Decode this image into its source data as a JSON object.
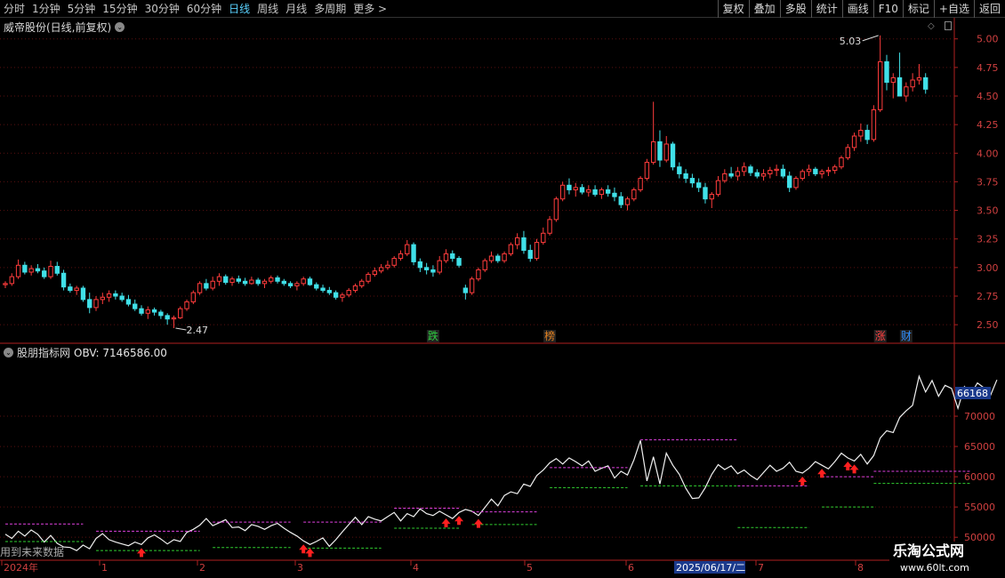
{
  "toolbar": {
    "periods": [
      "分时",
      "1分钟",
      "5分钟",
      "15分钟",
      "30分钟",
      "60分钟",
      "日线",
      "周线",
      "月线",
      "多周期",
      "更多 >"
    ],
    "active_period": "日线",
    "actions": [
      "复权",
      "叠加",
      "多股",
      "统计",
      "画线",
      "F10",
      "标记",
      "+自选",
      "返回"
    ]
  },
  "main_chart": {
    "title": "威帝股份(日线,前复权)",
    "high_label": "5.03",
    "low_label": "2.47",
    "price_ticks": [
      "5.00",
      "4.75",
      "4.50",
      "4.25",
      "4.00",
      "3.75",
      "3.50",
      "3.25",
      "3.00",
      "2.75",
      "2.50"
    ],
    "markers": [
      {
        "text": "跌",
        "color": "#2ecc40"
      },
      {
        "text": "榜",
        "color": "#e08020"
      },
      {
        "text": "涨",
        "color": "#ff4040"
      },
      {
        "text": "财",
        "color": "#3090ff"
      }
    ]
  },
  "indicator": {
    "title": "股朋指标网",
    "obv_label": "OBV: 7146586.00",
    "current_value": "66168",
    "ticks": [
      "70000",
      "65000",
      "60000",
      "55000",
      "50000"
    ]
  },
  "date_axis": {
    "labels": [
      "2024年",
      "1",
      "2",
      "3",
      "4",
      "5",
      "6",
      "7",
      "8"
    ],
    "cursor_date": "2025/06/17/二"
  },
  "bottom_note": "用到未来数据",
  "watermark": {
    "name": "乐淘公式网",
    "url": "www.60lt.com"
  },
  "chart_data": {
    "type": "candlestick",
    "candles": [
      [
        2.85,
        2.88,
        2.82,
        2.86
      ],
      [
        2.86,
        2.95,
        2.84,
        2.92
      ],
      [
        2.92,
        3.07,
        2.9,
        3.02
      ],
      [
        3.02,
        3.05,
        2.94,
        2.96
      ],
      [
        2.96,
        3.02,
        2.93,
        2.99
      ],
      [
        2.99,
        3.03,
        2.95,
        2.97
      ],
      [
        2.97,
        3.0,
        2.9,
        2.92
      ],
      [
        2.92,
        3.06,
        2.9,
        3.01
      ],
      [
        3.01,
        3.05,
        2.93,
        2.95
      ],
      [
        2.95,
        2.98,
        2.8,
        2.83
      ],
      [
        2.83,
        2.86,
        2.78,
        2.8
      ],
      [
        2.8,
        2.84,
        2.76,
        2.82
      ],
      [
        2.82,
        2.84,
        2.7,
        2.72
      ],
      [
        2.72,
        2.78,
        2.6,
        2.65
      ],
      [
        2.65,
        2.75,
        2.62,
        2.72
      ],
      [
        2.72,
        2.78,
        2.68,
        2.74
      ],
      [
        2.74,
        2.8,
        2.7,
        2.77
      ],
      [
        2.77,
        2.8,
        2.72,
        2.75
      ],
      [
        2.75,
        2.78,
        2.7,
        2.72
      ],
      [
        2.72,
        2.76,
        2.66,
        2.68
      ],
      [
        2.68,
        2.72,
        2.62,
        2.64
      ],
      [
        2.64,
        2.67,
        2.58,
        2.6
      ],
      [
        2.6,
        2.66,
        2.55,
        2.63
      ],
      [
        2.63,
        2.65,
        2.58,
        2.61
      ],
      [
        2.61,
        2.63,
        2.55,
        2.58
      ],
      [
        2.58,
        2.6,
        2.5,
        2.55
      ],
      [
        2.55,
        2.58,
        2.47,
        2.56
      ],
      [
        2.56,
        2.66,
        2.55,
        2.64
      ],
      [
        2.64,
        2.72,
        2.62,
        2.7
      ],
      [
        2.7,
        2.8,
        2.68,
        2.78
      ],
      [
        2.78,
        2.88,
        2.76,
        2.86
      ],
      [
        2.86,
        2.9,
        2.8,
        2.82
      ],
      [
        2.82,
        2.92,
        2.8,
        2.88
      ],
      [
        2.88,
        2.95,
        2.84,
        2.92
      ],
      [
        2.92,
        2.94,
        2.85,
        2.87
      ],
      [
        2.87,
        2.92,
        2.84,
        2.9
      ],
      [
        2.9,
        2.93,
        2.86,
        2.88
      ],
      [
        2.88,
        2.91,
        2.84,
        2.86
      ],
      [
        2.86,
        2.92,
        2.85,
        2.89
      ],
      [
        2.89,
        2.91,
        2.84,
        2.86
      ],
      [
        2.86,
        2.9,
        2.82,
        2.88
      ],
      [
        2.88,
        2.93,
        2.86,
        2.91
      ],
      [
        2.91,
        2.93,
        2.86,
        2.88
      ],
      [
        2.88,
        2.9,
        2.84,
        2.86
      ],
      [
        2.86,
        2.88,
        2.82,
        2.84
      ],
      [
        2.84,
        2.88,
        2.8,
        2.86
      ],
      [
        2.86,
        2.92,
        2.84,
        2.9
      ],
      [
        2.9,
        2.92,
        2.84,
        2.85
      ],
      [
        2.85,
        2.87,
        2.8,
        2.82
      ],
      [
        2.82,
        2.85,
        2.78,
        2.8
      ],
      [
        2.8,
        2.83,
        2.76,
        2.78
      ],
      [
        2.78,
        2.8,
        2.72,
        2.74
      ],
      [
        2.74,
        2.78,
        2.7,
        2.76
      ],
      [
        2.76,
        2.82,
        2.74,
        2.8
      ],
      [
        2.8,
        2.86,
        2.78,
        2.84
      ],
      [
        2.84,
        2.9,
        2.82,
        2.88
      ],
      [
        2.88,
        2.96,
        2.86,
        2.94
      ],
      [
        2.94,
        3.0,
        2.92,
        2.97
      ],
      [
        2.97,
        3.03,
        2.95,
        3.0
      ],
      [
        3.0,
        3.06,
        2.98,
        3.02
      ],
      [
        3.02,
        3.1,
        3.0,
        3.08
      ],
      [
        3.08,
        3.15,
        3.06,
        3.12
      ],
      [
        3.12,
        3.24,
        3.1,
        3.2
      ],
      [
        3.2,
        3.22,
        3.02,
        3.05
      ],
      [
        3.05,
        3.08,
        2.96,
        3.0
      ],
      [
        3.0,
        3.04,
        2.94,
        2.98
      ],
      [
        2.98,
        3.02,
        2.92,
        2.96
      ],
      [
        2.96,
        3.1,
        2.94,
        3.06
      ],
      [
        3.06,
        3.16,
        3.04,
        3.12
      ],
      [
        3.12,
        3.15,
        3.05,
        3.08
      ],
      [
        3.08,
        3.1,
        3.0,
        3.02
      ],
      [
        2.82,
        2.85,
        2.72,
        2.78
      ],
      [
        2.78,
        2.92,
        2.76,
        2.9
      ],
      [
        2.9,
        3.0,
        2.88,
        2.98
      ],
      [
        2.98,
        3.08,
        2.96,
        3.06
      ],
      [
        3.06,
        3.14,
        3.04,
        3.1
      ],
      [
        3.1,
        3.12,
        3.04,
        3.06
      ],
      [
        3.06,
        3.14,
        3.04,
        3.12
      ],
      [
        3.12,
        3.22,
        3.1,
        3.2
      ],
      [
        3.2,
        3.3,
        3.16,
        3.26
      ],
      [
        3.26,
        3.32,
        3.12,
        3.15
      ],
      [
        3.15,
        3.2,
        3.05,
        3.08
      ],
      [
        3.08,
        3.25,
        3.06,
        3.22
      ],
      [
        3.22,
        3.35,
        3.2,
        3.3
      ],
      [
        3.3,
        3.45,
        3.28,
        3.42
      ],
      [
        3.42,
        3.62,
        3.4,
        3.6
      ],
      [
        3.6,
        3.75,
        3.58,
        3.72
      ],
      [
        3.72,
        3.78,
        3.64,
        3.68
      ],
      [
        3.68,
        3.74,
        3.62,
        3.7
      ],
      [
        3.7,
        3.73,
        3.64,
        3.66
      ],
      [
        3.66,
        3.72,
        3.62,
        3.68
      ],
      [
        3.68,
        3.72,
        3.62,
        3.64
      ],
      [
        3.64,
        3.7,
        3.6,
        3.68
      ],
      [
        3.68,
        3.72,
        3.62,
        3.65
      ],
      [
        3.65,
        3.7,
        3.58,
        3.62
      ],
      [
        3.62,
        3.66,
        3.52,
        3.55
      ],
      [
        3.55,
        3.62,
        3.5,
        3.6
      ],
      [
        3.6,
        3.7,
        3.58,
        3.68
      ],
      [
        3.68,
        3.8,
        3.66,
        3.78
      ],
      [
        3.78,
        3.95,
        3.76,
        3.92
      ],
      [
        3.92,
        4.45,
        3.9,
        4.1
      ],
      [
        4.1,
        4.2,
        3.88,
        3.94
      ],
      [
        3.94,
        4.15,
        3.92,
        4.08
      ],
      [
        4.08,
        4.1,
        3.85,
        3.88
      ],
      [
        3.88,
        3.92,
        3.78,
        3.82
      ],
      [
        3.82,
        3.86,
        3.74,
        3.78
      ],
      [
        3.78,
        3.82,
        3.7,
        3.74
      ],
      [
        3.74,
        3.78,
        3.66,
        3.7
      ],
      [
        3.7,
        3.74,
        3.56,
        3.6
      ],
      [
        3.6,
        3.66,
        3.52,
        3.64
      ],
      [
        3.64,
        3.8,
        3.62,
        3.76
      ],
      [
        3.76,
        3.86,
        3.74,
        3.82
      ],
      [
        3.82,
        3.88,
        3.78,
        3.8
      ],
      [
        3.8,
        3.88,
        3.76,
        3.84
      ],
      [
        3.84,
        3.92,
        3.8,
        3.88
      ],
      [
        3.88,
        3.9,
        3.8,
        3.83
      ],
      [
        3.83,
        3.86,
        3.78,
        3.8
      ],
      [
        3.8,
        3.86,
        3.76,
        3.82
      ],
      [
        3.82,
        3.88,
        3.78,
        3.85
      ],
      [
        3.85,
        3.9,
        3.8,
        3.86
      ],
      [
        3.86,
        3.9,
        3.78,
        3.8
      ],
      [
        3.8,
        3.84,
        3.66,
        3.7
      ],
      [
        3.7,
        3.8,
        3.68,
        3.78
      ],
      [
        3.78,
        3.86,
        3.76,
        3.84
      ],
      [
        3.84,
        3.9,
        3.8,
        3.86
      ],
      [
        3.86,
        3.88,
        3.8,
        3.82
      ],
      [
        3.82,
        3.86,
        3.78,
        3.84
      ],
      [
        3.84,
        3.88,
        3.8,
        3.85
      ],
      [
        3.85,
        3.9,
        3.82,
        3.88
      ],
      [
        3.88,
        3.98,
        3.86,
        3.96
      ],
      [
        3.96,
        4.08,
        3.94,
        4.05
      ],
      [
        4.05,
        4.18,
        4.02,
        4.15
      ],
      [
        4.15,
        4.26,
        4.1,
        4.2
      ],
      [
        4.2,
        4.25,
        4.08,
        4.12
      ],
      [
        4.12,
        4.42,
        4.1,
        4.38
      ],
      [
        4.38,
        5.03,
        4.36,
        4.8
      ],
      [
        4.8,
        4.86,
        4.55,
        4.62
      ],
      [
        4.62,
        4.7,
        4.48,
        4.66
      ],
      [
        4.66,
        4.88,
        4.6,
        4.5
      ],
      [
        4.5,
        4.62,
        4.45,
        4.58
      ],
      [
        4.58,
        4.7,
        4.54,
        4.64
      ],
      [
        4.64,
        4.78,
        4.6,
        4.66
      ],
      [
        4.66,
        4.7,
        4.52,
        4.56
      ]
    ],
    "obv": [
      50500,
      49800,
      51000,
      50200,
      51200,
      50500,
      49200,
      50300,
      49000,
      48400,
      48300,
      47800,
      48700,
      48100,
      49800,
      50600,
      49600,
      49200,
      48900,
      48600,
      49200,
      48800,
      49900,
      50400,
      49700,
      48900,
      49600,
      49300,
      50800,
      51300,
      52000,
      53100,
      51900,
      52400,
      52900,
      51600,
      51700,
      51100,
      52100,
      51800,
      51300,
      51900,
      52300,
      51500,
      50800,
      50200,
      49400,
      48800,
      49300,
      49900,
      48500,
      49600,
      50900,
      52100,
      53300,
      52100,
      53400,
      53000,
      52700,
      53400,
      54100,
      52700,
      53900,
      53400,
      54700,
      53900,
      53600,
      54300,
      53700,
      53100,
      54100,
      54600,
      54300,
      53600,
      54900,
      56300,
      55200,
      56900,
      57500,
      57200,
      58800,
      58400,
      60200,
      61100,
      62300,
      63000,
      62100,
      63100,
      62500,
      61800,
      62600,
      60900,
      61400,
      61800,
      59800,
      60900,
      60300,
      62800,
      66000,
      59300,
      63300,
      58800,
      63900,
      61900,
      60400,
      58100,
      56400,
      56500,
      58200,
      60400,
      62000,
      61200,
      61800,
      60500,
      61100,
      60200,
      59500,
      60700,
      61900,
      60900,
      61400,
      62400,
      60900,
      60600,
      61400,
      62500,
      61900,
      61300,
      62500,
      63900,
      63100,
      62600,
      63700,
      62100,
      63500,
      66400,
      67600,
      67300,
      69800,
      70900,
      71800,
      76600,
      74000,
      75900,
      73300,
      75100,
      74600,
      71300,
      74900,
      73700,
      75500,
      74700,
      73400,
      76000
    ]
  }
}
